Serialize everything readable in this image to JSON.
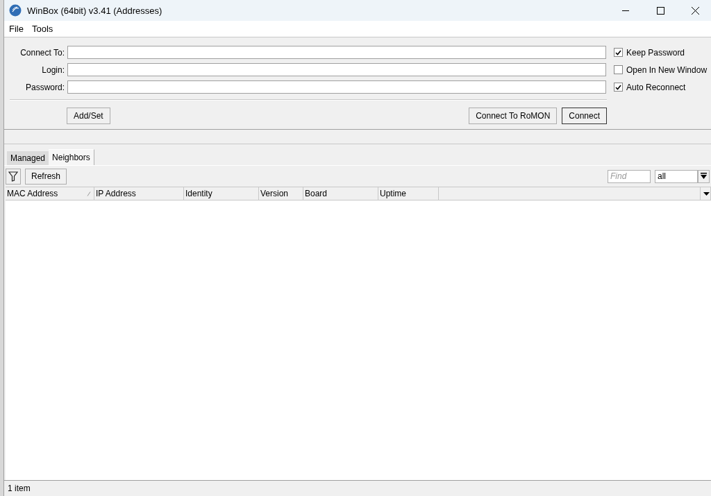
{
  "window": {
    "title": "WinBox (64bit) v3.41 (Addresses)"
  },
  "menu": [
    "File",
    "Tools"
  ],
  "form": {
    "fields": [
      {
        "label": "Connect To:"
      },
      {
        "label": "Login:"
      },
      {
        "label": "Password:"
      }
    ],
    "options": [
      {
        "label": "Keep Password",
        "checked": true
      },
      {
        "label": "Open In New Window",
        "checked": false
      },
      {
        "label": "Auto Reconnect",
        "checked": true
      }
    ],
    "add_button": "Add/Set",
    "buttons": [
      {
        "label": "Connect To RoMON",
        "default": false
      },
      {
        "label": "Connect",
        "default": true
      }
    ]
  },
  "tabs": [
    {
      "label": "Managed",
      "selected": false
    },
    {
      "label": "Neighbors",
      "selected": true
    }
  ],
  "toolbar": {
    "refresh": "Refresh",
    "find": {
      "placeholder": "Find"
    },
    "filter": {
      "value": "all"
    }
  },
  "table": {
    "columns": [
      {
        "label": "MAC Address",
        "sorted": true
      },
      {
        "label": "IP Address",
        "sorted": false
      },
      {
        "label": "Identity",
        "sorted": false
      },
      {
        "label": "Version",
        "sorted": false
      },
      {
        "label": "Board",
        "sorted": false
      },
      {
        "label": "Uptime",
        "sorted": false
      }
    ]
  },
  "status_bar": "1 item"
}
